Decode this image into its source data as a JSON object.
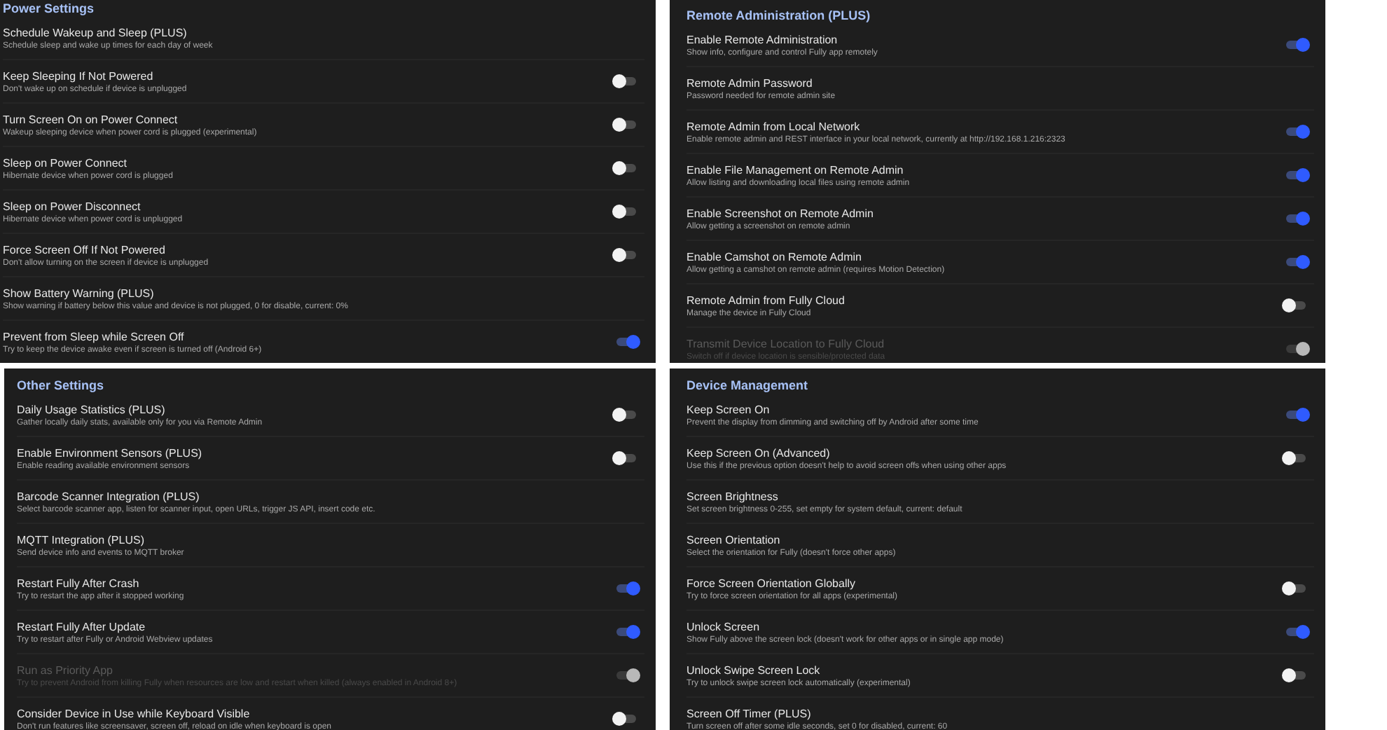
{
  "panels": [
    {
      "title": "Power Settings",
      "rows": [
        {
          "kind": "plain",
          "title": "Schedule Wakeup and Sleep (PLUS)",
          "subtitle": "Schedule sleep and wake up times for each day of week",
          "disabled": false
        },
        {
          "kind": "toggle",
          "title": "Keep Sleeping If Not Powered",
          "subtitle": "Don't wake up on schedule if device is unplugged",
          "disabled": false,
          "on": false
        },
        {
          "kind": "toggle",
          "title": "Turn Screen On on Power Connect",
          "subtitle": "Wakeup sleeping device when power cord is plugged (experimental)",
          "disabled": false,
          "on": false
        },
        {
          "kind": "toggle",
          "title": "Sleep on Power Connect",
          "subtitle": "Hibernate device when power cord is plugged",
          "disabled": false,
          "on": false
        },
        {
          "kind": "toggle",
          "title": "Sleep on Power Disconnect",
          "subtitle": "Hibernate device when power cord is unplugged",
          "disabled": false,
          "on": false
        },
        {
          "kind": "toggle",
          "title": "Force Screen Off If Not Powered",
          "subtitle": "Don't allow turning on the screen if device is unplugged",
          "disabled": false,
          "on": false
        },
        {
          "kind": "plain",
          "title": "Show Battery Warning (PLUS)",
          "subtitle": "Show warning if battery below this value and device is not plugged, 0 for disable, current: 0%",
          "disabled": false
        },
        {
          "kind": "toggle",
          "title": "Prevent from Sleep while Screen Off",
          "subtitle": "Try to keep the device awake even if screen is turned off (Android 6+)",
          "disabled": false,
          "on": true
        }
      ]
    },
    {
      "title": "Remote Administration (PLUS)",
      "rows": [
        {
          "kind": "toggle",
          "title": "Enable Remote Administration",
          "subtitle": "Show info, configure and control Fully app remotely",
          "disabled": false,
          "on": true
        },
        {
          "kind": "plain",
          "title": "Remote Admin Password",
          "subtitle": "Password needed for remote admin site",
          "disabled": false
        },
        {
          "kind": "toggle",
          "title": "Remote Admin from Local Network",
          "subtitle": "Enable remote admin and REST interface in your local network, currently at http://192.168.1.216:2323",
          "disabled": false,
          "on": true
        },
        {
          "kind": "toggle",
          "title": "Enable File Management on Remote Admin",
          "subtitle": "Allow listing and downloading local files using remote admin",
          "disabled": false,
          "on": true
        },
        {
          "kind": "toggle",
          "title": "Enable Screenshot on Remote Admin",
          "subtitle": "Allow getting a screenshot on remote admin",
          "disabled": false,
          "on": true
        },
        {
          "kind": "toggle",
          "title": "Enable Camshot on Remote Admin",
          "subtitle": "Allow getting a camshot on remote admin (requires Motion Detection)",
          "disabled": false,
          "on": true
        },
        {
          "kind": "toggle",
          "title": "Remote Admin from Fully Cloud",
          "subtitle": "Manage the device in Fully Cloud",
          "disabled": false,
          "on": false
        },
        {
          "kind": "toggle",
          "title": "Transmit Device Location to Fully Cloud",
          "subtitle": "Switch off if device location is sensible/protected data",
          "disabled": true,
          "on": true
        }
      ]
    },
    {
      "title": "Other Settings",
      "rows": [
        {
          "kind": "toggle",
          "title": "Daily Usage Statistics (PLUS)",
          "subtitle": "Gather locally daily stats, available only for you via Remote Admin",
          "disabled": false,
          "on": false
        },
        {
          "kind": "toggle",
          "title": "Enable Environment Sensors (PLUS)",
          "subtitle": "Enable reading available environment sensors",
          "disabled": false,
          "on": false
        },
        {
          "kind": "plain",
          "title": "Barcode Scanner Integration (PLUS)",
          "subtitle": "Select barcode scanner app, listen for scanner input, open URLs, trigger JS API, insert code etc.",
          "disabled": false
        },
        {
          "kind": "plain",
          "title": "MQTT Integration (PLUS)",
          "subtitle": "Send device info and events to MQTT broker",
          "disabled": false
        },
        {
          "kind": "toggle",
          "title": "Restart Fully After Crash",
          "subtitle": "Try to restart the app after it stopped working",
          "disabled": false,
          "on": true
        },
        {
          "kind": "toggle",
          "title": "Restart Fully After Update",
          "subtitle": "Try to restart after Fully or Android Webview updates",
          "disabled": false,
          "on": true
        },
        {
          "kind": "toggle",
          "title": "Run as Priority App",
          "subtitle": "Try to prevent Android from killing Fully when resources are low and restart when killed (always enabled in Android 8+)",
          "disabled": true,
          "on": true
        },
        {
          "kind": "toggle",
          "title": "Consider Device in Use while Keyboard Visible",
          "subtitle": "Don't run features like screensaver, screen off, reload on idle when keyboard is open",
          "disabled": false,
          "on": false
        }
      ]
    },
    {
      "title": "Device Management",
      "rows": [
        {
          "kind": "toggle",
          "title": "Keep Screen On",
          "subtitle": "Prevent the display from dimming and switching off by Android after some time",
          "disabled": false,
          "on": true
        },
        {
          "kind": "toggle",
          "title": "Keep Screen On (Advanced)",
          "subtitle": "Use this if the previous option doesn't help to avoid screen offs when using other apps",
          "disabled": false,
          "on": false
        },
        {
          "kind": "plain",
          "title": "Screen Brightness",
          "subtitle": "Set screen brightness 0-255, set empty for system default, current: default",
          "disabled": false
        },
        {
          "kind": "plain",
          "title": "Screen Orientation",
          "subtitle": "Select the orientation for Fully (doesn't force other apps)",
          "disabled": false
        },
        {
          "kind": "toggle",
          "title": "Force Screen Orientation Globally",
          "subtitle": "Try to force screen orientation for all apps (experimental)",
          "disabled": false,
          "on": false
        },
        {
          "kind": "toggle",
          "title": "Unlock Screen",
          "subtitle": "Show Fully above the screen lock (doesn't work for other apps or in single app mode)",
          "disabled": false,
          "on": true
        },
        {
          "kind": "toggle",
          "title": "Unlock Swipe Screen Lock",
          "subtitle": "Try to unlock swipe screen lock automatically (experimental)",
          "disabled": false,
          "on": false
        },
        {
          "kind": "plain",
          "title": "Screen Off Timer (PLUS)",
          "subtitle": "Turn screen off after some idle seconds, set 0 for disabled, current: 60",
          "disabled": false
        }
      ]
    }
  ]
}
